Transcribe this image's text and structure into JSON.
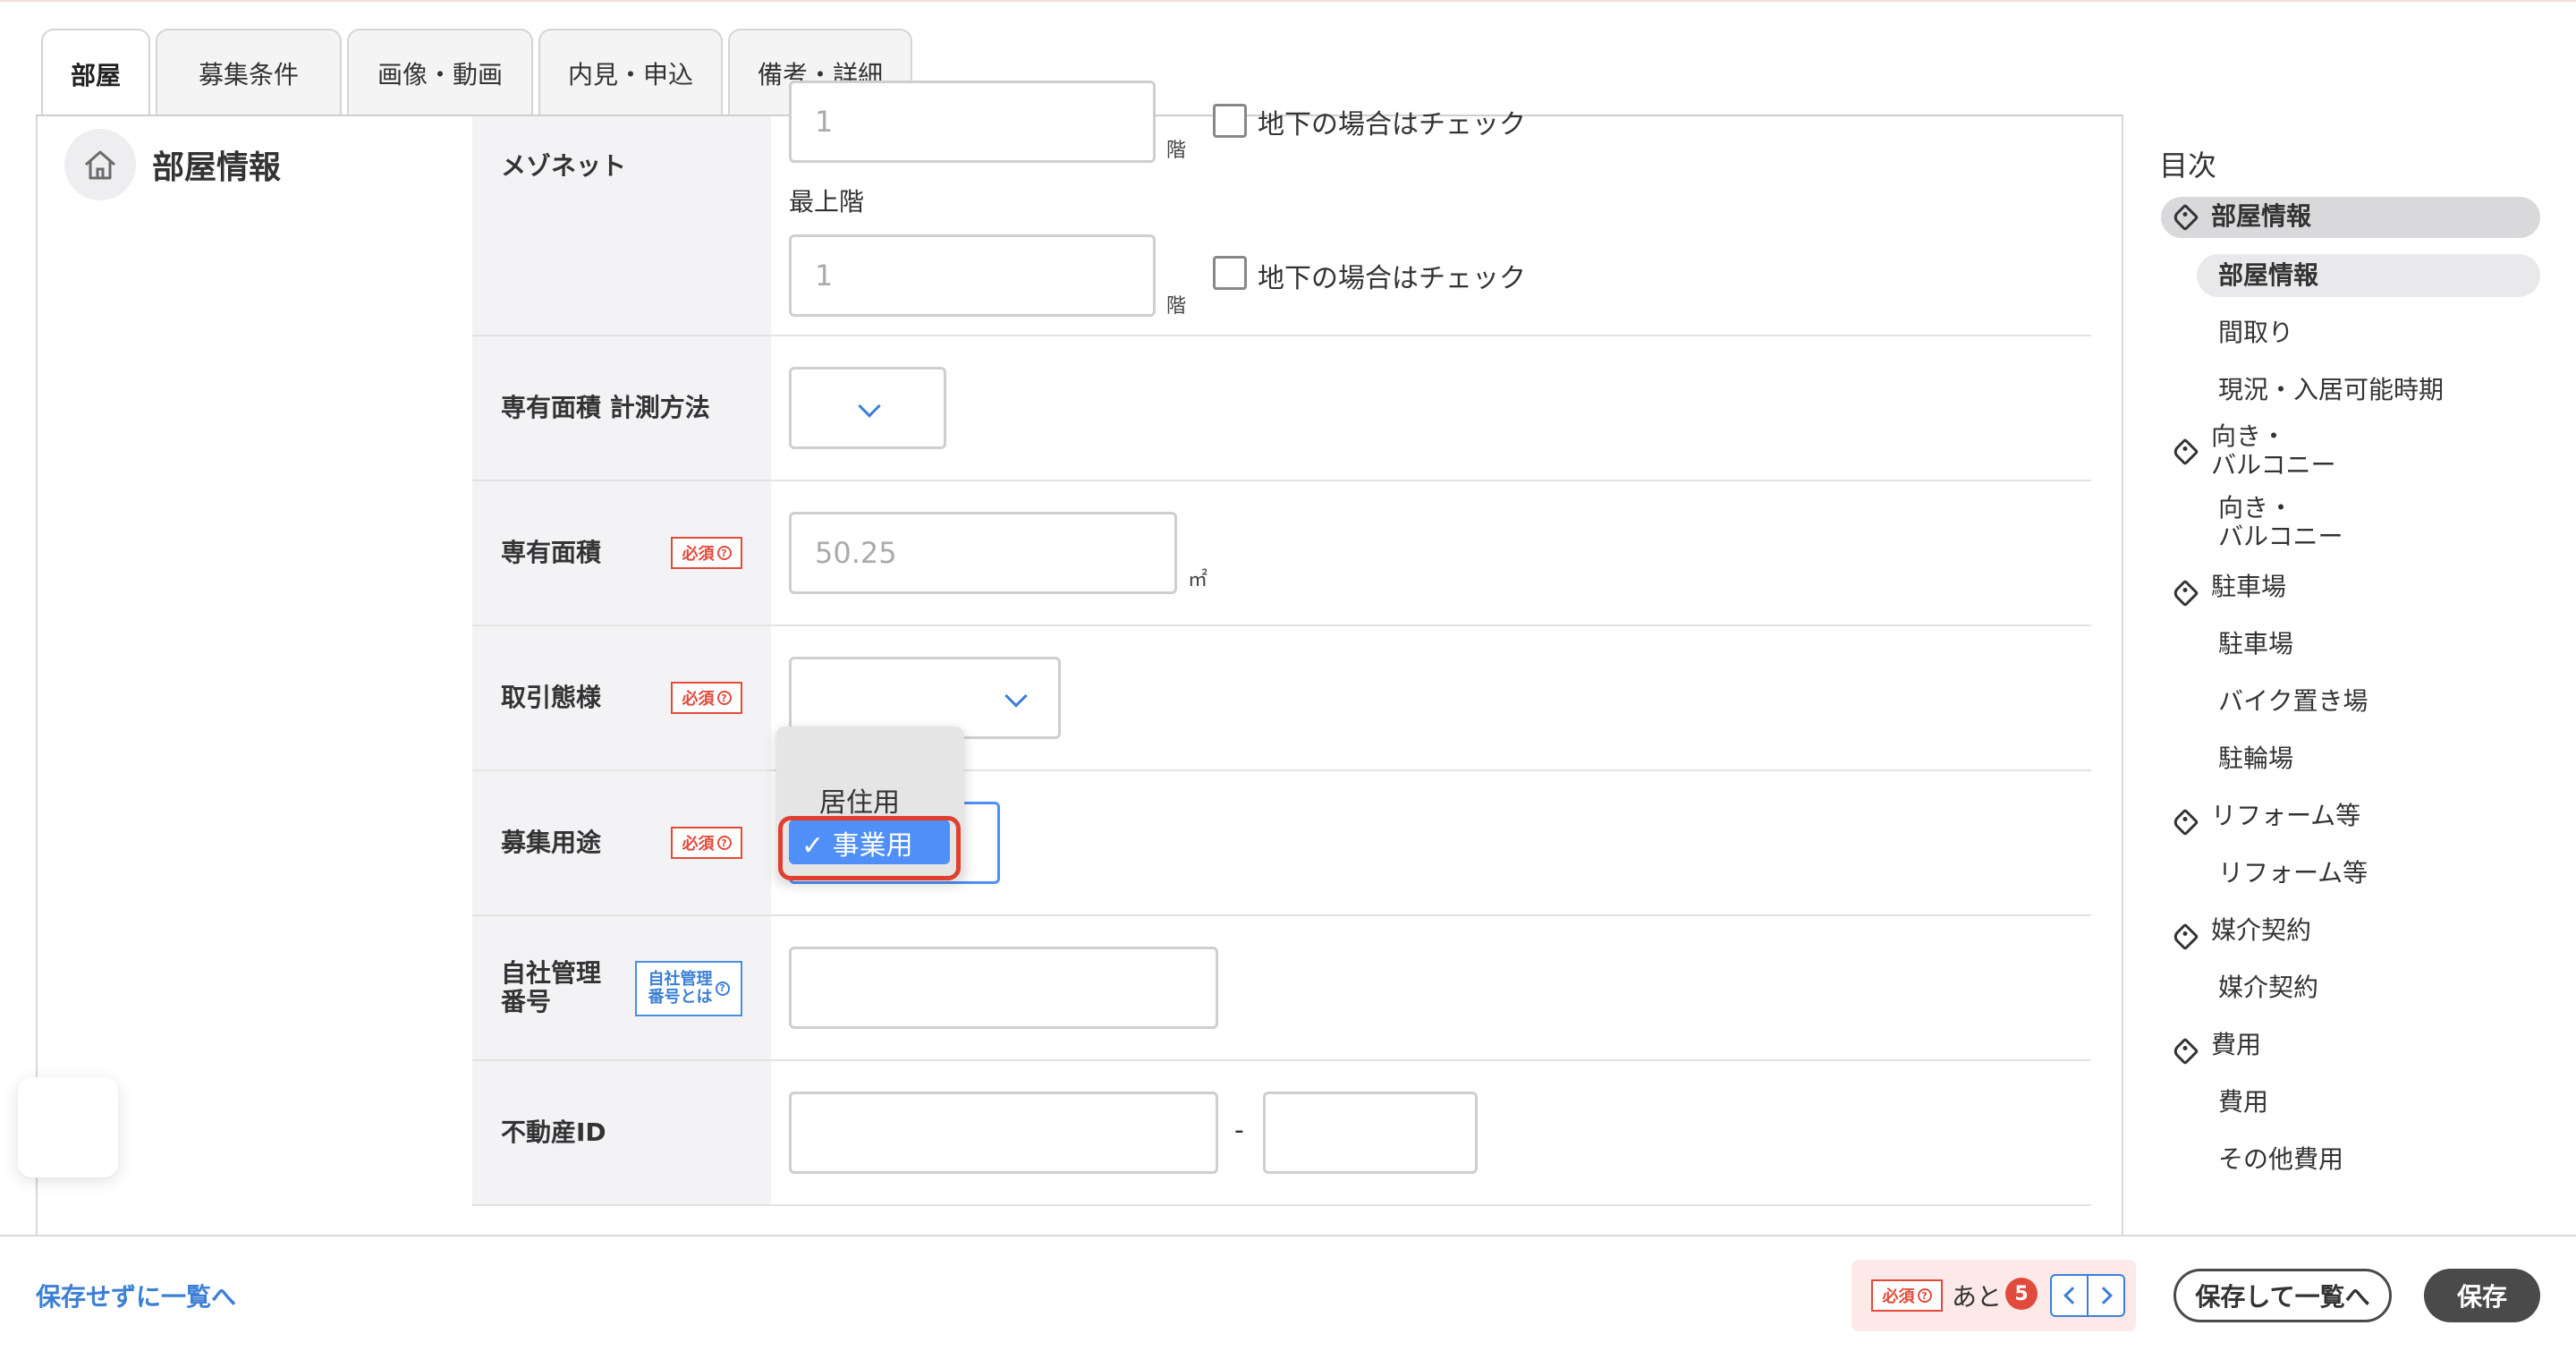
{
  "tabs": [
    {
      "label": "部屋",
      "active": true
    },
    {
      "label": "募集条件",
      "active": false
    },
    {
      "label": "画像・動画",
      "active": false
    },
    {
      "label": "内見・申込",
      "active": false
    },
    {
      "label": "備考・詳細",
      "active": false
    }
  ],
  "section": {
    "title": "部屋情報",
    "icon": "home-icon"
  },
  "badges": {
    "required": "必須",
    "help_symbol": "?"
  },
  "form": {
    "maisonette": {
      "label": "メゾネット",
      "floor_value": "1",
      "floor_unit": "階",
      "basement_label": "地下の場合はチェック",
      "top_floor_label": "最上階",
      "top_floor_placeholder": "1",
      "top_floor_unit": "階",
      "top_basement_label": "地下の場合はチェック"
    },
    "area_method": {
      "label": "専有面積 計測方法",
      "value": ""
    },
    "area": {
      "label": "専有面積",
      "placeholder": "50.25",
      "unit": "㎡"
    },
    "transaction": {
      "label": "取引態様",
      "value": ""
    },
    "purpose": {
      "label": "募集用途",
      "options": [
        "居住用",
        "事業用"
      ],
      "selected": "✓ 事業用"
    },
    "mgmt_number": {
      "label_line1": "自社管理",
      "label_line2": "番号",
      "info_line1": "自社管理",
      "info_line2": "番号とは",
      "value": ""
    },
    "property_id": {
      "label": "不動産ID",
      "separator": "-",
      "value1": "",
      "value2": ""
    }
  },
  "toc": {
    "title": "目次",
    "items": [
      {
        "label": "部屋情報",
        "type": "group",
        "active": true
      },
      {
        "label": "部屋情報",
        "type": "sub",
        "active": true
      },
      {
        "label": "間取り",
        "type": "sub"
      },
      {
        "label": "現況・入居可能時期",
        "type": "sub"
      },
      {
        "label": "向き・",
        "label2": "バルコニー",
        "type": "group"
      },
      {
        "label": "向き・",
        "label2": "バルコニー",
        "type": "sub"
      },
      {
        "label": "駐車場",
        "type": "group"
      },
      {
        "label": "駐車場",
        "type": "sub"
      },
      {
        "label": "バイク置き場",
        "type": "sub"
      },
      {
        "label": "駐輪場",
        "type": "sub"
      },
      {
        "label": "リフォーム等",
        "type": "group"
      },
      {
        "label": "リフォーム等",
        "type": "sub"
      },
      {
        "label": "媒介契約",
        "type": "group"
      },
      {
        "label": "媒介契約",
        "type": "sub"
      },
      {
        "label": "費用",
        "type": "group"
      },
      {
        "label": "費用",
        "type": "sub"
      },
      {
        "label": "その他費用",
        "type": "sub"
      }
    ]
  },
  "footer": {
    "back_link": "保存せずに一覧へ",
    "remaining_prefix": "あと",
    "remaining_count": "5",
    "save_and_list": "保存して一覧へ",
    "save": "保存"
  },
  "colors": {
    "accent": "#3c7fd6",
    "required": "#e24b3b",
    "selected": "#4f8ff7",
    "dark_button": "#4a4a4a"
  }
}
